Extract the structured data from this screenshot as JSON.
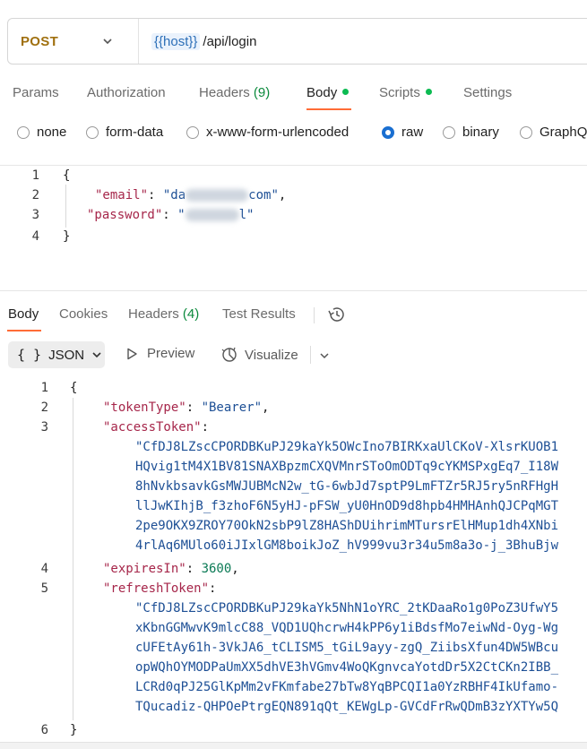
{
  "request": {
    "method": "POST",
    "url_variable": "{{host}}",
    "url_path": "/api/login"
  },
  "request_tabs": [
    {
      "label": "Params"
    },
    {
      "label": "Authorization"
    },
    {
      "label": "Headers",
      "count": "(9)"
    },
    {
      "label": "Body",
      "active": true,
      "dot": true
    },
    {
      "label": "Scripts",
      "dot": true
    },
    {
      "label": "Settings"
    }
  ],
  "body_types": [
    {
      "label": "none"
    },
    {
      "label": "form-data"
    },
    {
      "label": "x-www-form-urlencoded"
    },
    {
      "label": "raw",
      "checked": true
    },
    {
      "label": "binary"
    },
    {
      "label": "GraphQ"
    }
  ],
  "request_body": {
    "line_numbers": [
      "1",
      "2",
      "3",
      "4"
    ],
    "open_brace": "{",
    "email_key": "\"email\"",
    "email_value_start": "\"da",
    "email_value_end": "com\"",
    "password_key": "\"password\"",
    "password_value_start": "\"",
    "password_value_end": "l\"",
    "close_brace": "}"
  },
  "response_tabs": [
    {
      "label": "Body",
      "active": true
    },
    {
      "label": "Cookies"
    },
    {
      "label": "Headers",
      "count": "(4)"
    },
    {
      "label": "Test Results"
    }
  ],
  "response_toolbar": {
    "format_icon": "{ }",
    "format_label": "JSON",
    "preview_label": "Preview",
    "visualize_label": "Visualize"
  },
  "response_body": {
    "line_numbers": [
      "1",
      "2",
      "3",
      "4",
      "5",
      "6"
    ],
    "open_brace": "{",
    "token_type_key": "\"tokenType\"",
    "token_type_value": "\"Bearer\"",
    "access_token_key": "\"accessToken\"",
    "access_token_lines": [
      "\"CfDJ8LZscCPORDBKuPJ29kaYk5OWcIno7BIRKxaUlCKoV-XlsrKUOB1",
      "HQvig1tM4X1BV81SNAXBpzmCXQVMnrSToOmODTq9cYKMSPxgEq7_I18W",
      "8hNvkbsavkGsMWJUBMcN2w_tG-6wbJd7sptP9LmFTZr5RJ5ry5nRFHgH",
      "llJwKIhjB_f3zhoF6N5yHJ-pFSW_yU0HnOD9d8hpb4HMHAnhQJCPqMGT",
      "2pe9OKX9ZROY70OkN2sbP9lZ8HAShDUihrimMTursrElHMup1dh4XNbi",
      "4rlAq6MUlo60iJIxlGM8boikJoZ_hV999vu3r34u5m8a3o-j_3BhuBjw"
    ],
    "expires_in_key": "\"expiresIn\"",
    "expires_in_value": "3600",
    "refresh_token_key": "\"refreshToken\"",
    "refresh_token_lines": [
      "\"CfDJ8LZscCPORDBKuPJ29kaYk5NhN1oYRC_2tKDaaRo1g0PoZ3UfwY5",
      "xKbnGGMwvK9mlcC88_VQD1UQhcrwH4kPP6y1iBdsfMo7eiwNd-Oyg-Wg",
      "cUFEtAy61h-3VkJA6_tCLISM5_tGiL9ayy-zgQ_ZiibsXfun4DW5WBcu",
      "opWQhOYMODPaUmXX5dhVE3hVGmv4WoQKgnvcaYotdDr5X2CtCKn2IBB_",
      "LCRd0qPJ25GlKpMm2vFKmfabe27bTw8YqBPCQI1a0YzRBHF4IkUfamo-",
      "TQucadiz-QHPOePtrgEQN891qQt_KEWgLp-GVCdFrRwQDmB3zYXTYw5Q"
    ],
    "close_brace": "}"
  },
  "colors": {
    "method": "#a0700f",
    "accent_underline": "#ff6c37",
    "status_dot": "#0cbb52",
    "json_key": "#a6264a",
    "json_string": "#1d4f95",
    "json_number": "#0b7a55"
  }
}
